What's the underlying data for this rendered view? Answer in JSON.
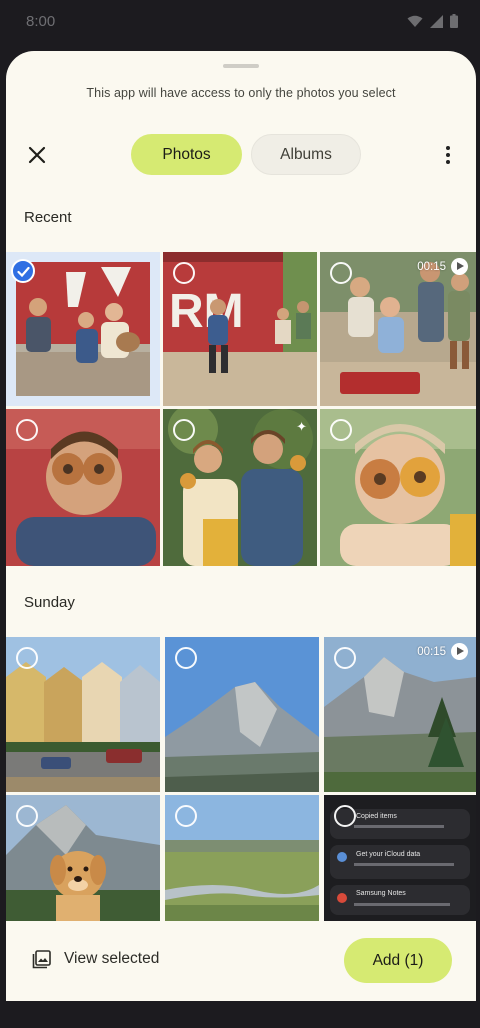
{
  "status_bar": {
    "time": "8:00",
    "icons": [
      "wifi-icon",
      "signal-icon",
      "battery-icon"
    ]
  },
  "picker": {
    "notice": "This app will have access to only the photos you select",
    "close_icon": "close-icon",
    "more_icon": "more-vert-icon",
    "tabs": [
      {
        "label": "Photos",
        "selected": true
      },
      {
        "label": "Albums",
        "selected": false
      }
    ]
  },
  "sections": [
    {
      "label": "Recent"
    },
    {
      "label": "Sunday"
    }
  ],
  "recent_photos": [
    {
      "description": "kids-by-red-barn",
      "selected": true
    },
    {
      "description": "boy-running-by-barn",
      "selected": false
    },
    {
      "description": "family-in-wagon",
      "selected": false,
      "video_duration": "00:15"
    },
    {
      "description": "boy-with-donut-eyes",
      "selected": false
    },
    {
      "description": "two-boys-eating-donuts",
      "selected": false,
      "sparkle": true
    },
    {
      "description": "girl-with-donut-eyes",
      "selected": false
    }
  ],
  "sunday_photos": [
    {
      "description": "painted-ladies-houses",
      "selected": false
    },
    {
      "description": "half-dome",
      "selected": false
    },
    {
      "description": "valley-view",
      "selected": false,
      "video_duration": "00:15"
    },
    {
      "description": "dog-in-mountains",
      "selected": false
    },
    {
      "description": "meadow-river",
      "selected": false
    },
    {
      "description": "screenshot-notifications",
      "selected": false
    }
  ],
  "screenshot_items": [
    "Copied items",
    "Get your iCloud data",
    "Samsung Notes"
  ],
  "bottom_bar": {
    "view_selected_label": "View selected",
    "add_label": "Add (1)"
  },
  "colors": {
    "accent": "#d6ea72",
    "check": "#2f6fe3",
    "sheet": "#fbf9f0"
  }
}
